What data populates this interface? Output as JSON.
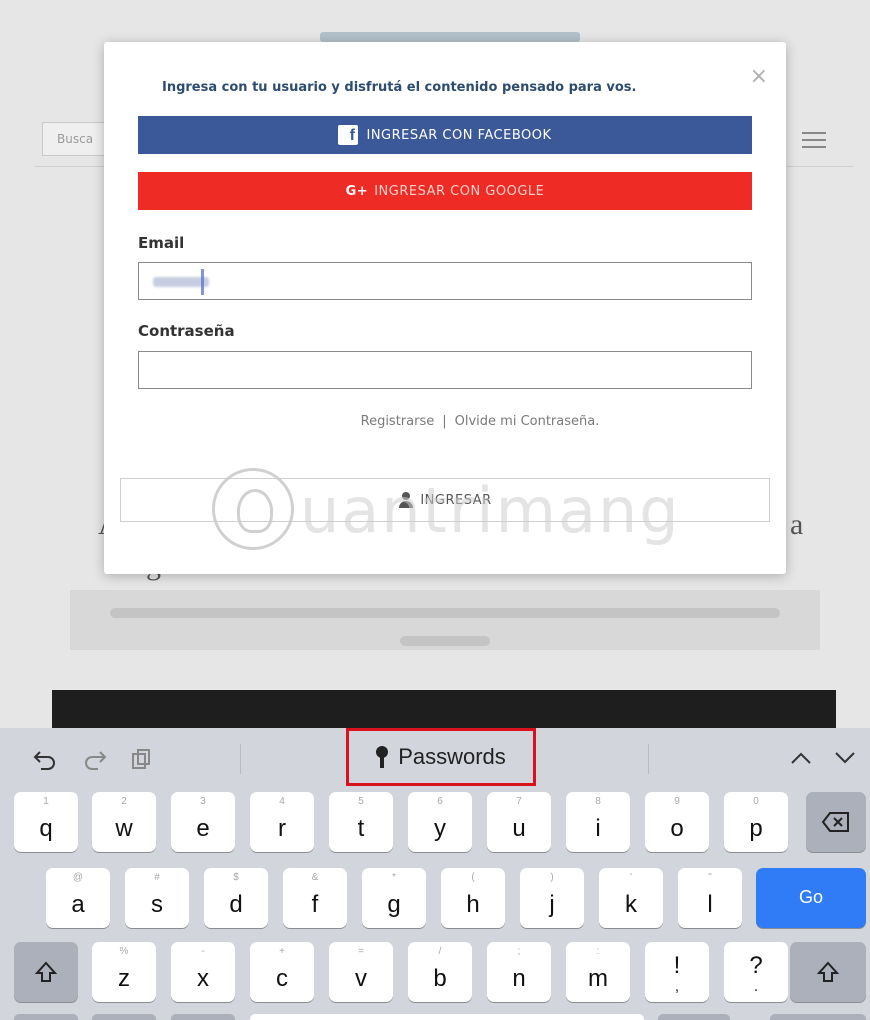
{
  "background": {
    "search_placeholder": "Busca",
    "heading_left": "A",
    "heading_right": "a",
    "heading_line2": "g"
  },
  "modal": {
    "close_label": "×",
    "intro": "Ingresa con tu usuario y disfrutá el contenido pensado para vos.",
    "facebook_label": "INGRESAR CON FACEBOOK",
    "facebook_icon_glyph": "f",
    "google_label": "INGRESAR CON GOOGLE",
    "google_icon_glyph": "G+",
    "email_label": "Email",
    "password_label": "Contraseña",
    "email_value": "",
    "password_value": "",
    "register_link": "Registrarse",
    "link_separator": "|",
    "forgot_link": "Olvide mi Contraseña.",
    "submit_label": "INGRESAR"
  },
  "watermark": {
    "text": "uantrimang"
  },
  "keyboard": {
    "toolbar": {
      "undo_icon": "undo-icon",
      "redo_icon": "redo-icon",
      "paste_icon": "paste-icon",
      "passwords_label": "Passwords",
      "prev_icon": "chevron-up-icon",
      "next_icon": "chevron-down-icon"
    },
    "rows": [
      [
        {
          "main": "q",
          "sub": "1"
        },
        {
          "main": "w",
          "sub": "2"
        },
        {
          "main": "e",
          "sub": "3"
        },
        {
          "main": "r",
          "sub": "4"
        },
        {
          "main": "t",
          "sub": "5"
        },
        {
          "main": "y",
          "sub": "6"
        },
        {
          "main": "u",
          "sub": "7"
        },
        {
          "main": "i",
          "sub": "8"
        },
        {
          "main": "o",
          "sub": "9"
        },
        {
          "main": "p",
          "sub": "0"
        }
      ],
      [
        {
          "main": "a",
          "sub": "@"
        },
        {
          "main": "s",
          "sub": "#"
        },
        {
          "main": "d",
          "sub": "$"
        },
        {
          "main": "f",
          "sub": "&"
        },
        {
          "main": "g",
          "sub": "*"
        },
        {
          "main": "h",
          "sub": "("
        },
        {
          "main": "j",
          "sub": ")"
        },
        {
          "main": "k",
          "sub": "'"
        },
        {
          "main": "l",
          "sub": "\""
        }
      ],
      [
        {
          "main": "z",
          "sub": "%"
        },
        {
          "main": "x",
          "sub": "-"
        },
        {
          "main": "c",
          "sub": "+"
        },
        {
          "main": "v",
          "sub": "="
        },
        {
          "main": "b",
          "sub": "/"
        },
        {
          "main": "n",
          "sub": ";"
        },
        {
          "main": "m",
          "sub": ":"
        },
        {
          "main": "!",
          "sub": ""
        },
        {
          "main": "?",
          "sub": ""
        }
      ]
    ],
    "row3_sub_extra": [
      ",",
      "."
    ],
    "go_label": "Go",
    "backspace_icon": "backspace-icon",
    "shift_icon": "shift-icon"
  }
}
